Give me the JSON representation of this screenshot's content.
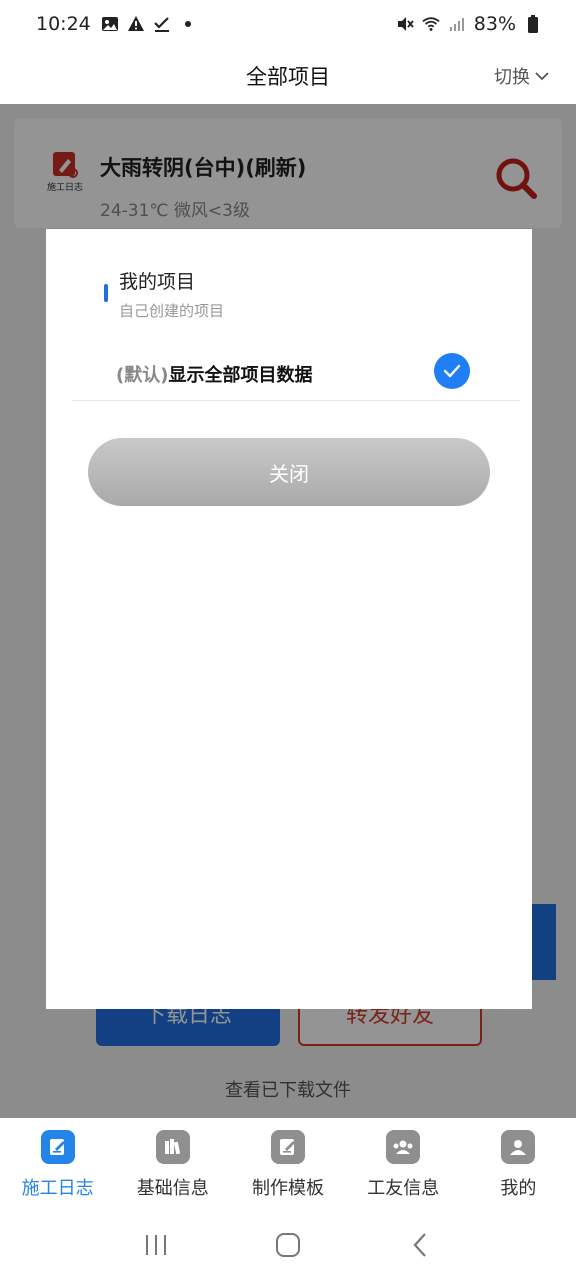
{
  "status": {
    "time": "10:24",
    "battery": "83%"
  },
  "header": {
    "title": "全部项目",
    "switch_label": "切换"
  },
  "background": {
    "weather_title": "大雨转阴(台中)(刷新)",
    "weather_sub": "24-31℃ 微风<3级",
    "logo_text": "施工日志",
    "download_label": "下载日志",
    "forward_label": "转发好友",
    "view_files": "查看已下载文件"
  },
  "modal": {
    "my_project_title": "我的项目",
    "my_project_sub": "自己创建的项目",
    "default_prefix": "(默认)",
    "all_projects_label": "显示全部项目数据",
    "close_label": "关闭"
  },
  "tabs": [
    {
      "label": "施工日志",
      "icon": "log-icon",
      "active": true
    },
    {
      "label": "基础信息",
      "icon": "books-icon",
      "active": false
    },
    {
      "label": "制作模板",
      "icon": "template-icon",
      "active": false
    },
    {
      "label": "工友信息",
      "icon": "workers-icon",
      "active": false
    },
    {
      "label": "我的",
      "icon": "profile-icon",
      "active": false
    }
  ],
  "colors": {
    "accent": "#1f6fe0",
    "danger": "#d23a2a"
  }
}
